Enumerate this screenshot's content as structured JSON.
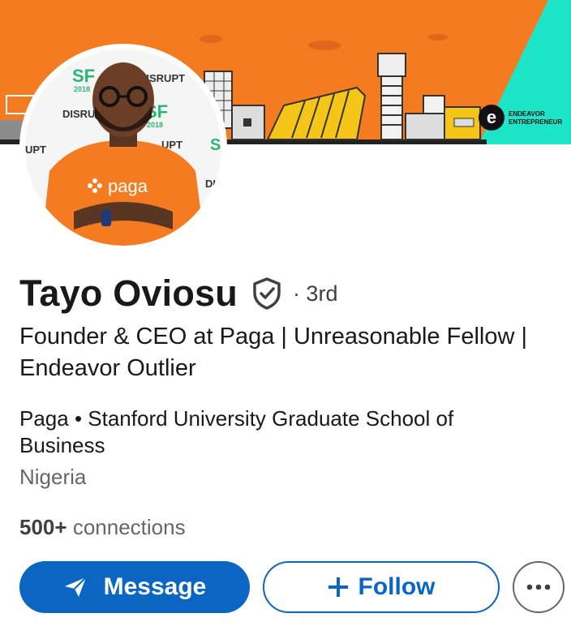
{
  "profile": {
    "name": "Tayo Oviosu",
    "degree": "· 3rd",
    "headline_line1": "Founder & CEO at Paga | Unreasonable Fellow |",
    "headline_line2": "Endeavor Outlier",
    "education": "Paga • Stanford University Graduate School of Business",
    "location": "Nigeria",
    "connections_count": "500+",
    "connections_label": "connections"
  },
  "banner": {
    "brand_line1": "ENDEAVOR",
    "brand_line2": "ENTREPRENEUR",
    "colors": {
      "orange": "#f47b20",
      "teal": "#1de5c8"
    }
  },
  "avatar": {
    "shirt_text": "paga",
    "backdrop_texts": [
      "SF",
      "2018",
      "DISRUPT",
      "DISRUPT",
      "SF",
      "2018",
      "UPT",
      "UPT",
      "S",
      "DI"
    ]
  },
  "actions": {
    "message_label": "Message",
    "follow_label": "Follow",
    "more_icon": "more-horizontal-icon",
    "message_icon": "send-icon",
    "follow_icon": "plus-icon"
  },
  "colors": {
    "primary": "#0a66c2",
    "text": "#191919",
    "muted": "#666666"
  }
}
